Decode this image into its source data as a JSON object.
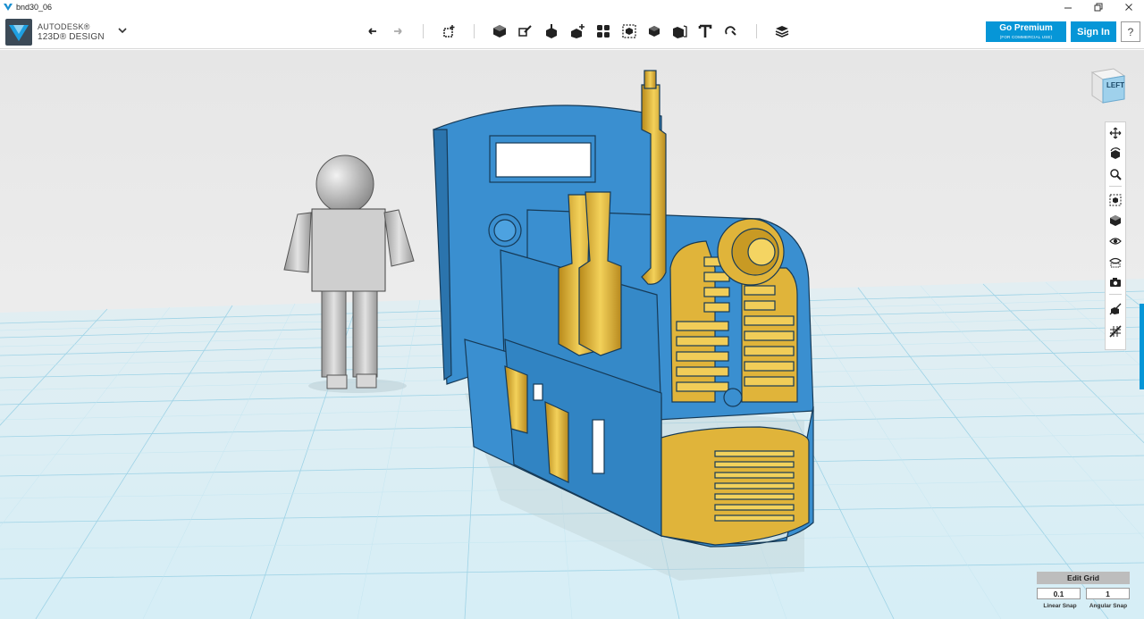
{
  "window": {
    "title": "bnd30_06",
    "icon": "app-triangle-icon",
    "buttons": [
      "minimize-icon",
      "maximize-icon",
      "close-icon"
    ]
  },
  "brand": {
    "company": "AUTODESK®",
    "product": "123D® DESIGN",
    "logo": "123d-design-logo"
  },
  "toolbar": {
    "tools": [
      "undo-icon",
      "redo-icon",
      "transform-icon",
      "primitives-icon",
      "sketch-icon",
      "construct-icon",
      "modify-icon",
      "pattern-icon",
      "grouping-icon",
      "combine-icon",
      "measure-icon",
      "text-icon",
      "snap-icon",
      "material-icon"
    ],
    "premium_label": "Go Premium",
    "premium_sub": "(FOR COMMERCIAL USE)",
    "signin_label": "Sign In",
    "help_label": "?"
  },
  "viewcube": {
    "face_label": "LEFT"
  },
  "navbar": {
    "items": [
      "pan-icon",
      "orbit-icon",
      "zoom-icon",
      "fit-icon",
      "views-icon",
      "visibility-icon",
      "material-view-icon",
      "screenshot-icon",
      "solid-snap-icon",
      "grid-snap-icon"
    ]
  },
  "grid": {
    "edit_label": "Edit Grid",
    "linear_value": "0.1",
    "angular_value": "1",
    "linear_label": "Linear Snap",
    "angular_label": "Angular Snap"
  },
  "colors": {
    "accent": "#0696d7",
    "model_blue": "#3a8fd0",
    "model_gold": "#e0b43a",
    "grid_line": "#8fcfe6",
    "mannequin": "#bdbdbd"
  }
}
